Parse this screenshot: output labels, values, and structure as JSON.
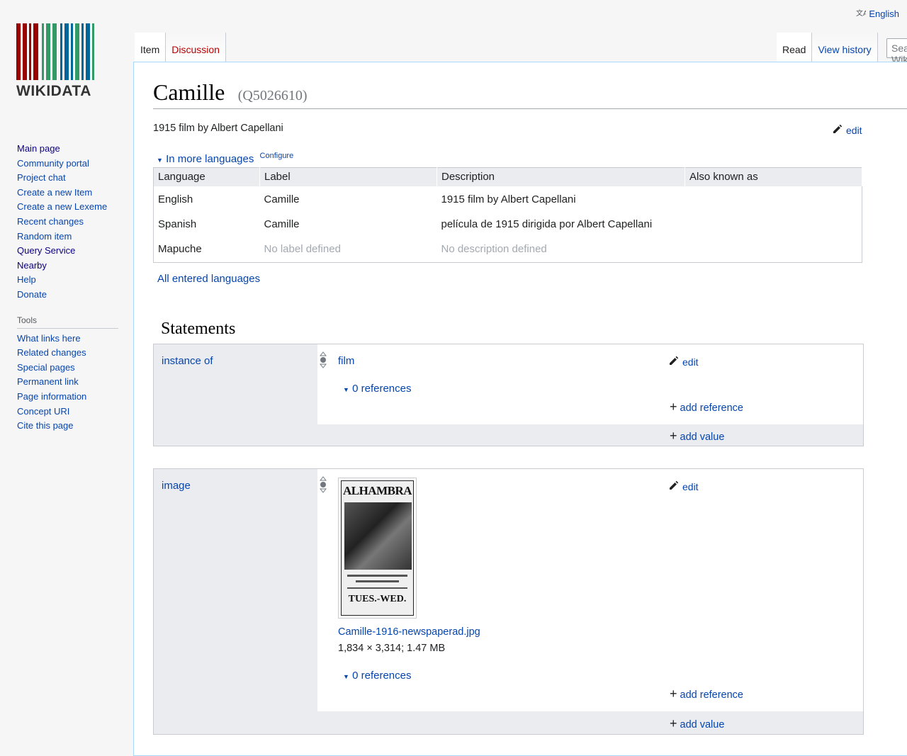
{
  "header": {
    "language_label": "English",
    "search_placeholder": "Search Wikidata"
  },
  "logo": {
    "word": "WIKIDATA"
  },
  "tabs": {
    "left": [
      "Item",
      "Discussion"
    ],
    "right": [
      "Read",
      "View history"
    ]
  },
  "sidebar": {
    "nav": [
      "Main page",
      "Community portal",
      "Project chat",
      "Create a new Item",
      "Create a new Lexeme",
      "Recent changes",
      "Random item",
      "Query Service",
      "Nearby",
      "Help",
      "Donate"
    ],
    "tools_heading": "Tools",
    "tools": [
      "What links here",
      "Related changes",
      "Special pages",
      "Permanent link",
      "Page information",
      "Concept URI",
      "Cite this page"
    ]
  },
  "item": {
    "title": "Camille",
    "qid": "(Q5026610)",
    "description": "1915 film by Albert Capellani",
    "edit_label": "edit",
    "more_languages": "In more languages",
    "configure": "Configure",
    "all_languages": "All entered languages"
  },
  "lang_table": {
    "headers": [
      "Language",
      "Label",
      "Description",
      "Also known as"
    ],
    "rows": [
      {
        "language": "English",
        "label": "Camille",
        "description": "1915 film by Albert Capellani",
        "aliases": ""
      },
      {
        "language": "Spanish",
        "label": "Camille",
        "description": "película de 1915 dirigida por Albert Capellani",
        "aliases": ""
      },
      {
        "language": "Mapuche",
        "label": "No label defined",
        "description": "No description defined",
        "aliases": ""
      }
    ]
  },
  "statements": {
    "heading": "Statements",
    "groups": [
      {
        "property": "instance of",
        "value": "film",
        "references": "0 references",
        "edit": "edit",
        "add_reference": "add reference",
        "add_value": "add value"
      },
      {
        "property": "image",
        "file_name": "Camille-1916-newspaperad.jpg",
        "file_meta": "1,834 × 3,314; 1.47 MB",
        "poster_title": "ALHAMBRA",
        "poster_bottom": "TUES.-WED.",
        "references": "0 references",
        "edit": "edit",
        "add_reference": "add reference",
        "add_value": "add value"
      }
    ]
  },
  "colors": {
    "logo_red": "#990000",
    "logo_green": "#339966",
    "logo_blue": "#006699",
    "link": "#0645ad"
  }
}
